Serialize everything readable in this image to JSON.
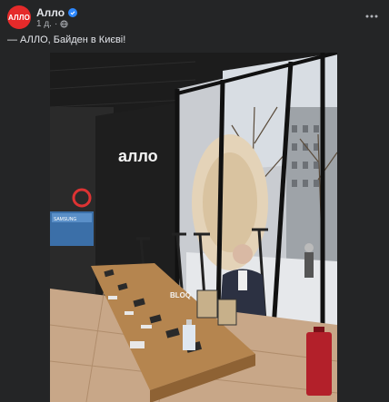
{
  "page": {
    "author": {
      "name": "Алло",
      "avatar_text": "АЛЛО"
    },
    "meta": {
      "time": "1 д.",
      "separator": "·"
    },
    "post_text": "— АЛЛО, Байден в Києві!",
    "photo": {
      "store_sign": "алло",
      "tv_text": "SAMSUNG",
      "price_tag": "BLOQ"
    }
  }
}
